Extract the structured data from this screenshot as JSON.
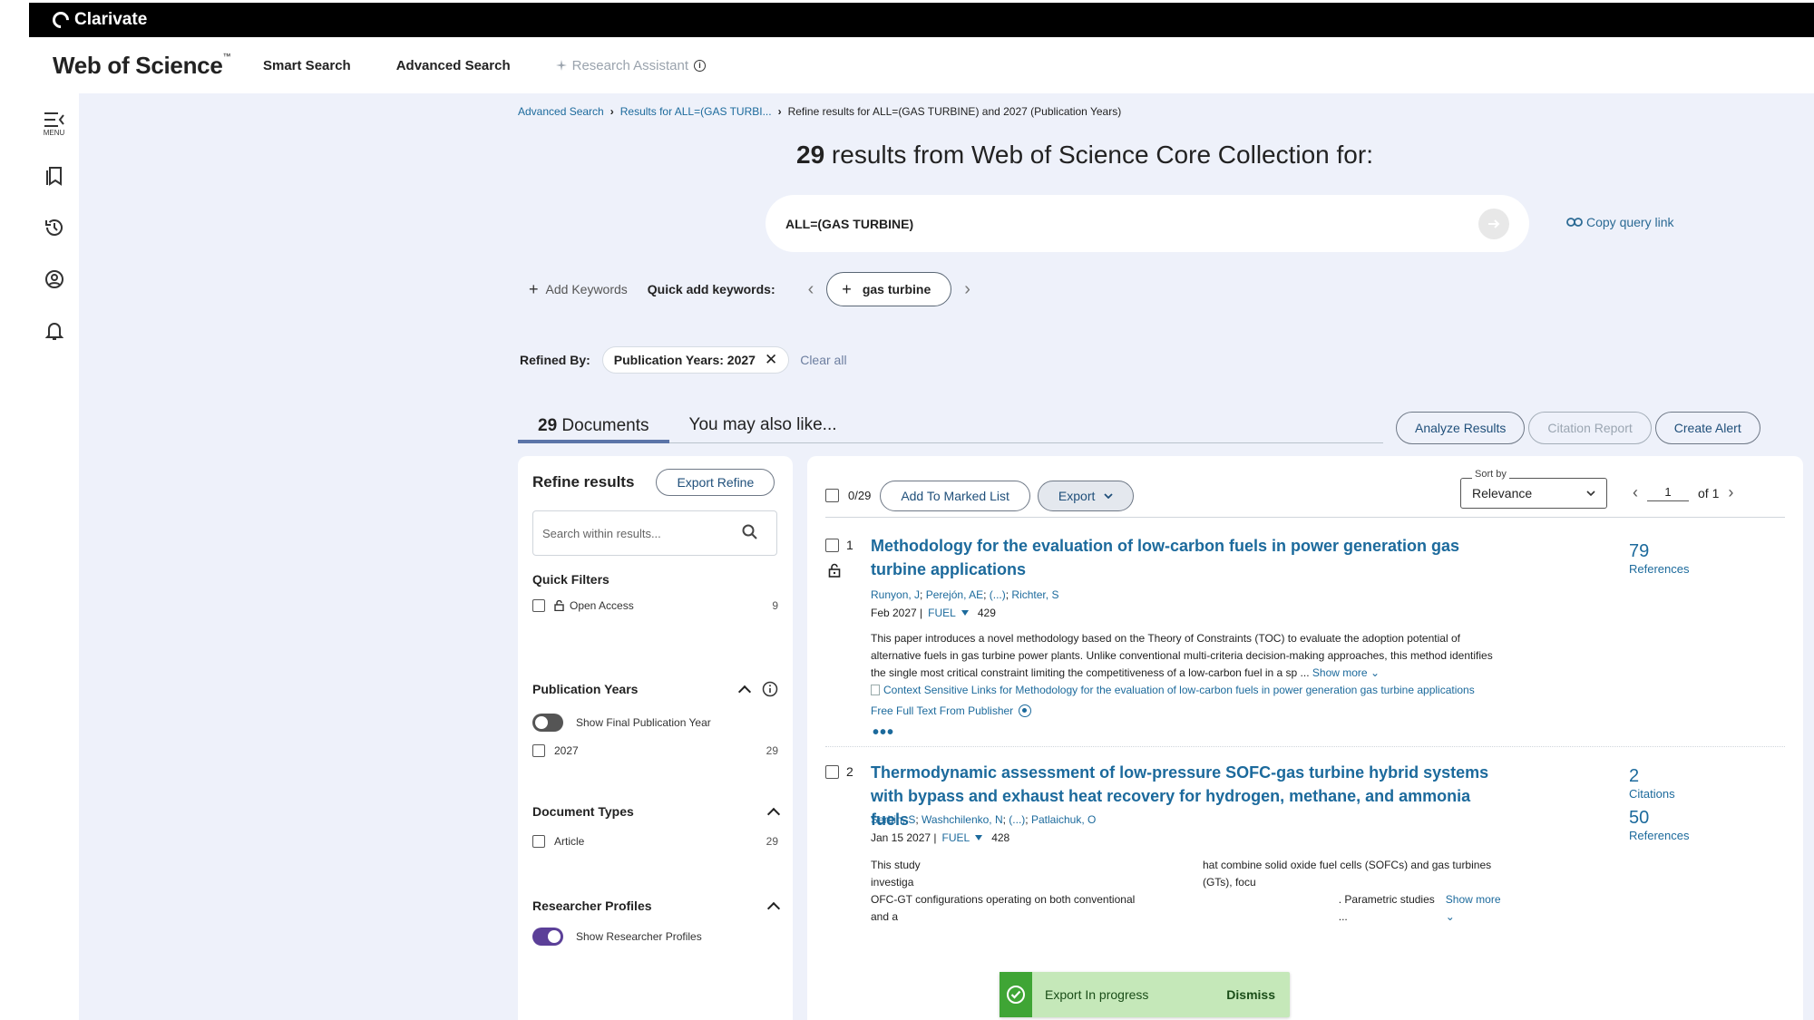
{
  "brand": {
    "name": "Clarivate"
  },
  "header": {
    "product": "Web of Science",
    "trademark": "™",
    "nav": [
      "Smart Search",
      "Advanced Search"
    ],
    "assistant": "Research Assistant"
  },
  "rail": {
    "menu_label": "MENU"
  },
  "breadcrumb": {
    "items": [
      "Advanced Search",
      "Results for ALL=(GAS TURBI...",
      "Refine results for ALL=(GAS TURBINE) and 2027 (Publication Years)"
    ]
  },
  "headline": {
    "count": "29",
    "text": " results from Web of Science Core Collection for:"
  },
  "query": {
    "value": "ALL=(GAS TURBINE)",
    "copy_link": "Copy query link"
  },
  "keywords": {
    "add_label": "Add Keywords",
    "quick_label": "Quick add keywords:",
    "chip": "gas turbine"
  },
  "refined": {
    "label": "Refined By:",
    "pill": "Publication Years: 2027",
    "clear": "Clear all"
  },
  "tabs": {
    "count": "29",
    "documents": " Documents",
    "also_like": "You may also like..."
  },
  "actions": [
    "Analyze Results",
    "Citation Report",
    "Create Alert"
  ],
  "refine_panel": {
    "title": "Refine results",
    "export_btn": "Export Refine",
    "search_placeholder": "Search within results...",
    "quick_filters": {
      "title": "Quick Filters",
      "items": [
        {
          "label": "Open Access",
          "count": "9"
        }
      ]
    },
    "pub_years": {
      "title": "Publication Years",
      "toggle_label": "Show Final Publication Year",
      "items": [
        {
          "label": "2027",
          "count": "29"
        }
      ]
    },
    "doc_types": {
      "title": "Document Types",
      "items": [
        {
          "label": "Article",
          "count": "29"
        }
      ]
    },
    "researcher": {
      "title": "Researcher Profiles",
      "toggle_label": "Show Researcher Profiles"
    }
  },
  "results_toolbar": {
    "selected": "0/29",
    "add_marked": "Add To Marked List",
    "export": "Export",
    "sort_legend": "Sort by",
    "sort_value": "Relevance",
    "page": "1",
    "of_pages": "of 1"
  },
  "records": [
    {
      "num": "1",
      "title": "Methodology for the evaluation of low-carbon fuels in power generation gas turbine applications",
      "authors": [
        "Runyon, J",
        "Perejón, AE",
        "(...)",
        "Richter, S"
      ],
      "date": "Feb 2027 |",
      "journal": "FUEL",
      "volume": "429",
      "abstract": "This paper introduces a novel methodology based on the Theory of Constraints (TOC) to evaluate the adoption potential of alternative fuels in gas turbine power plants. Unlike conventional multi-criteria decision-making approaches, this method identifies the single most critical constraint limiting the competitiveness of a low-carbon fuel in a sp ...",
      "show_more": "Show more",
      "csl": "Context Sensitive Links for Methodology for the evaluation of low-carbon fuels in power generation gas turbine applications",
      "fft": "Free Full Text From Publisher",
      "metrics": [
        {
          "value": "79",
          "label": "References"
        }
      ]
    },
    {
      "num": "2",
      "title": "Thermodynamic assessment of low-pressure SOFC-gas turbine hybrid systems with bypass and exhaust heat recovery for hydrogen, methane, and ammonia fuels",
      "authors": [
        "Serbin, S",
        "Washchilenko, N",
        "(...)",
        "Patlaichuk, O"
      ],
      "date": "Jan 15 2027 |",
      "journal": "FUEL",
      "volume": "428",
      "abstract_parts": [
        "This study investiga",
        "hat combine solid oxide fuel cells (SOFCs) and gas turbines (GTs), focu",
        "OFC-GT configurations operating on both conventional and a",
        ". Parametric studies ..."
      ],
      "show_more": "Show more",
      "metrics": [
        {
          "value": "2",
          "label": "Citations"
        },
        {
          "value": "50",
          "label": "References"
        }
      ]
    }
  ],
  "toast": {
    "message": "Export In progress",
    "dismiss": "Dismiss"
  }
}
